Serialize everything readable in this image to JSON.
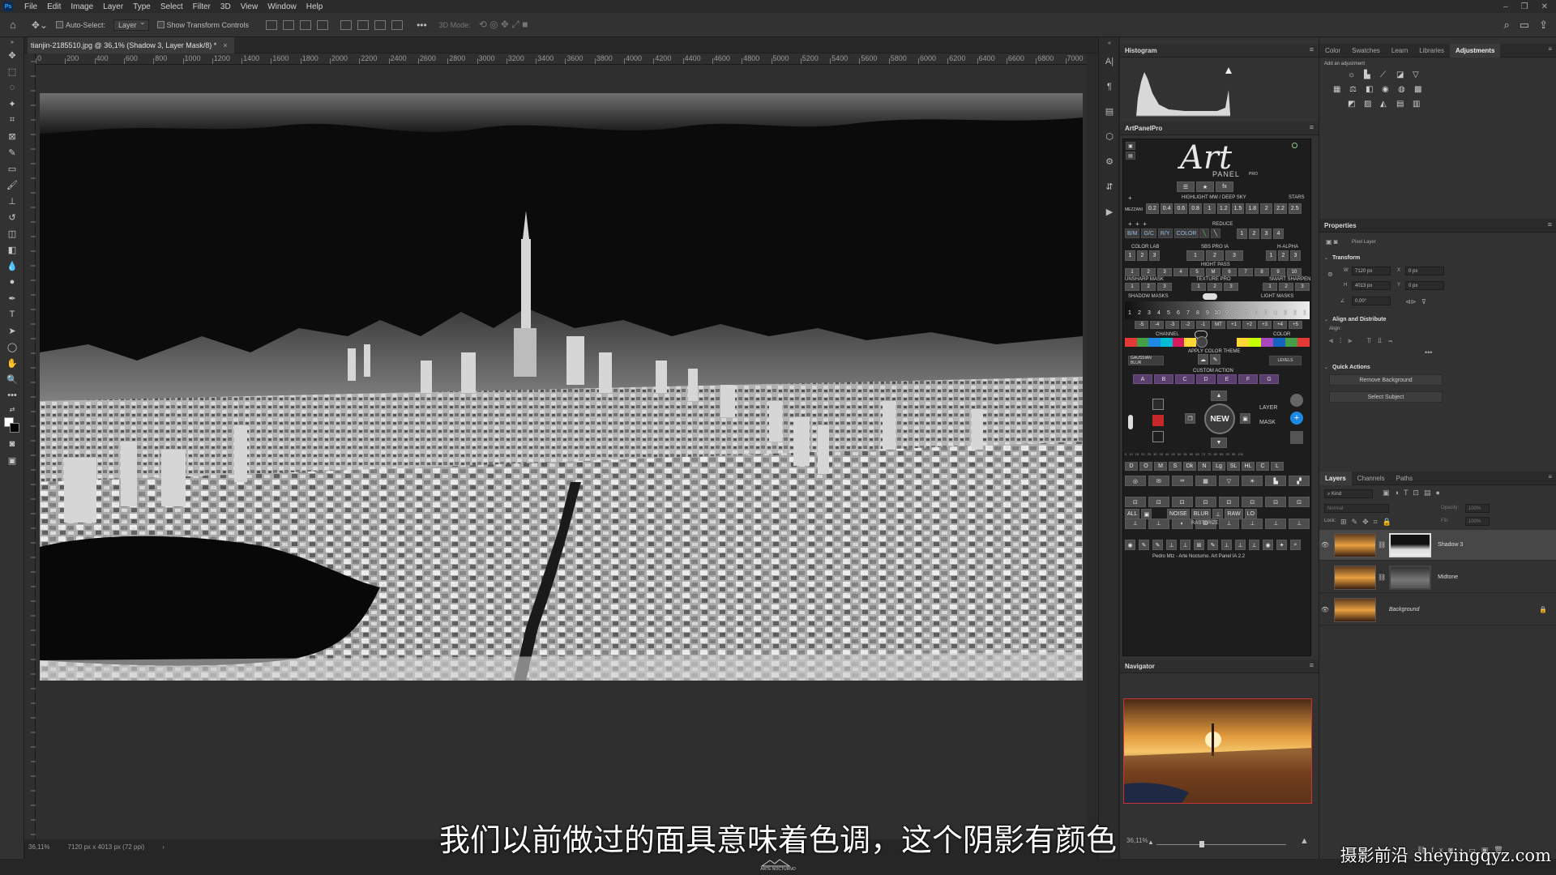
{
  "menu": [
    "File",
    "Edit",
    "Image",
    "Layer",
    "Type",
    "Select",
    "Filter",
    "3D",
    "View",
    "Window",
    "Help"
  ],
  "options_bar": {
    "auto_select_label": "Auto-Select:",
    "auto_select_value": "Layer",
    "transform_label": "Show Transform Controls",
    "mode_label": "3D Mode:"
  },
  "document": {
    "tab_title": "tianjin-2185510.jpg @ 36,1% (Shadow 3, Layer Mask/8) *",
    "zoom": "36,11%",
    "dimensions": "7120 px x 4013 px (72 ppi)"
  },
  "ruler_ticks": [
    "0",
    "200",
    "400",
    "600",
    "800",
    "1000",
    "1200",
    "1400",
    "1600",
    "1800",
    "2000",
    "2200",
    "2400",
    "2600",
    "2800",
    "3000",
    "3200",
    "3400",
    "3600",
    "3800",
    "4000",
    "4200",
    "4400",
    "4600",
    "4800",
    "5000",
    "5200",
    "5400",
    "5600",
    "5800",
    "6000",
    "6200",
    "6400",
    "6600",
    "6800",
    "7000"
  ],
  "panels": {
    "histogram_title": "Histogram",
    "artpanel_title": "ArtPanelPro",
    "navigator_title": "Navigator",
    "properties_title": "Properties"
  },
  "artpanel": {
    "logo_main": "Art",
    "logo_sub": "PANEL",
    "logo_pro": "PRO",
    "highlight_label": "HIGHLIGHT MW / DEEP SKY",
    "stars_label": "STARS",
    "mezzani_label": "MEZZANI",
    "hl_values": [
      "0.2",
      "0.4",
      "0.6",
      "0.8",
      "1",
      "1.2",
      "1.5",
      "1.8",
      "2",
      "2.2",
      "2.5"
    ],
    "reduce_label": "REDUCE",
    "bm_buttons": [
      "B/M",
      "G/C",
      "R/Y",
      "COLOR"
    ],
    "reduce_nums": [
      "1",
      "2",
      "3",
      "4"
    ],
    "colorlab_label": "COLOR LAB",
    "sbs_label": "SBS PRO IA",
    "halpha_label": "H-ALPHA",
    "colorlab_nums": [
      "1",
      "2",
      "3"
    ],
    "sbs_nums": [
      "1",
      "2",
      "3"
    ],
    "halpha_nums": [
      "1",
      "2",
      "3"
    ],
    "highpass_label": "HIGHT PASS",
    "highpass_nums": [
      "1",
      "2",
      "3",
      "4",
      "5",
      "M",
      "6",
      "7",
      "8",
      "9",
      "10"
    ],
    "unsharp_label": "UNSHARP MASK",
    "texture_label": "TEXTURE PRO",
    "smart_label": "SMART SHARPEN",
    "unsharp_nums": [
      "1",
      "2",
      "3"
    ],
    "texture_nums": [
      "1",
      "2",
      "3"
    ],
    "smart_nums": [
      "1",
      "2",
      "3"
    ],
    "shadow_masks_label": "SHADOW MASKS",
    "light_masks_label": "LIGHT MASKS",
    "mask_nums": [
      "1",
      "2",
      "3",
      "4",
      "5",
      "6",
      "7",
      "8",
      "9",
      "10",
      "9",
      "8",
      "7",
      "6",
      "5",
      "4",
      "3",
      "2",
      "1"
    ],
    "adjust_nums": [
      "-5",
      "-4",
      "-3",
      "-2",
      "-1",
      "MT",
      "+1",
      "+2",
      "+3",
      "+4",
      "+5"
    ],
    "channel_label": "CHANNEL",
    "color_label": "COLOR",
    "apply_theme_label": "APPLY COLOR THEME",
    "gaussian_label": "GAUSSIAN BLUR",
    "levels_label": "LEVELS",
    "custom_action_label": "CUSTOM ACTION",
    "custom_actions": [
      "A",
      "B",
      "C",
      "D",
      "E",
      "F",
      "G"
    ],
    "new_label": "NEW",
    "layer_label": "LAYER",
    "mask_label": "MASK",
    "ruler_nums": [
      "5",
      "10",
      "15",
      "20",
      "25",
      "30",
      "35",
      "40",
      "45",
      "50",
      "55",
      "60",
      "65",
      "70",
      "75",
      "80",
      "85",
      "90",
      "95",
      "100"
    ],
    "mode_buttons": [
      "D",
      "O",
      "M",
      "S",
      "Dk",
      "N",
      "Lg",
      "SL",
      "HL",
      "C",
      "L"
    ],
    "all_label": "ALL",
    "noise_label": "NOISE",
    "blur_label": "BLUR",
    "raw_label": "RAW",
    "lo_label": "LO",
    "rasterize_label": "RASTERIZE",
    "footer": "Pedro Mtz - Arte Nocturno. Art Panel IA 2.2"
  },
  "right_tabs": [
    "Color",
    "Swatches",
    "Learn",
    "Libraries",
    "Adjustments"
  ],
  "adjustments": {
    "add_label": "Add an adjustment"
  },
  "properties": {
    "layer_type": "Pixel Layer",
    "transform_label": "Transform",
    "w_label": "W",
    "w_value": "7120 px",
    "h_label": "H",
    "h_value": "4013 px",
    "x_label": "X",
    "x_value": "0 px",
    "y_label": "Y",
    "y_value": "0 px",
    "angle_value": "0,00°",
    "align_label": "Align and Distribute",
    "align_sub": "Align:",
    "quick_actions_label": "Quick Actions",
    "remove_bg": "Remove Background",
    "select_subject": "Select Subject"
  },
  "layers": {
    "tabs": [
      "Layers",
      "Channels",
      "Paths"
    ],
    "kind_label": "Kind",
    "blend_mode": "Normal",
    "opacity_label": "Opacity:",
    "opacity_value": "100%",
    "lock_label": "Lock:",
    "fill_label": "Fill:",
    "fill_value": "100%",
    "items": [
      {
        "name": "Shadow 3",
        "selected": true
      },
      {
        "name": "Midtone",
        "selected": false
      },
      {
        "name": "Background",
        "selected": false
      }
    ]
  },
  "subtitle": "我们以前做过的面具意味着色调，这个阴影有颜色",
  "watermark": "摄影前沿 sheyingqyz.com",
  "bottom_logo": "ARTE NOCTURNO"
}
